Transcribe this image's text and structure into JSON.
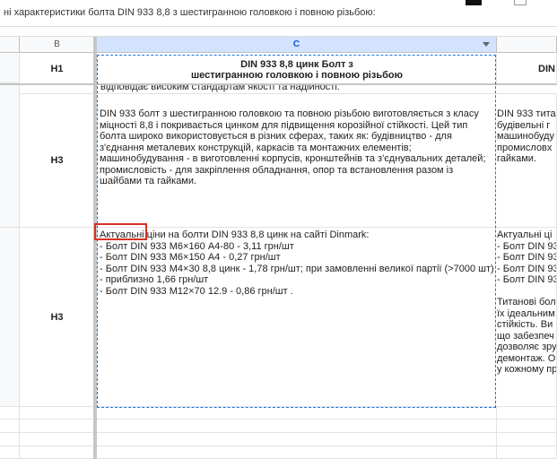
{
  "formula_bar": {
    "text": "ні характеристики болта DIN 933 8,8 з шестигранною головкою і повною різьбою:"
  },
  "columns": [
    {
      "label": "B"
    },
    {
      "label": "C"
    },
    {
      "label": ""
    }
  ],
  "header_row": {
    "b": "H1",
    "c_line1": "DIN 933 8,8 цинк Болт з",
    "c_line2": "шестигранною головкою і повною різьбою",
    "d": "DIN"
  },
  "row_partial": {
    "c": "відповідає високим стандартам якості та надійності."
  },
  "row_a": {
    "b": "H3",
    "c": "DIN 933 болт з шестигранною головкою та повною різьбою виготовляється з класу\nміцності 8,8 і покривається цинком для підвищення корозійної стійкості. Цей тип\nболта широко використовується в різних сферах, таких як: будівництво - для\nз'єднання металевих конструкцій, каркасів та монтажних елементів;\nмашинобудування - в виготовленні корпусів, кронштейнів та з'єднувальних деталей;\nпромисловість - для закріплення обладнання, опор та встановлення разом із\nшайбами та гайками.",
    "d": "DIN 933 тита\nбудівельні г\nмашинобуду\nпромисловх\nгайками."
  },
  "row_b": {
    "b": "H3",
    "c_first": "Актуальні",
    "c_rest": " ціни на болти DIN 933 8,8 цинк на сайті Dinmark:",
    "c_lines": "- Болт DIN 933 М6×160 А4-80 - 3,11 грн/шт\n- Болт DIN 933 М6×150 А4 - 0,27 грн/шт\n- Болт DIN 933 М4×30 8,8 цинк - 1,78 грн/шт; при замовленні великої партії (>7000 шт)\n- приблизно 1,66 грн/шт\n- Болт DIN 933 М12×70 12.9 - 0,86 грн/шт .",
    "d": "Актуальні ці\n- Болт DIN 93\n- Болт DIN 93\n- Болт DIN 93\n- Болт DIN 93\n\nТитанові бол\nїх ідеальним\nстійкість. Ви\nщо забезпеч\nдозволяє зру\nдемонтаж. О\nу кожному пр"
  }
}
